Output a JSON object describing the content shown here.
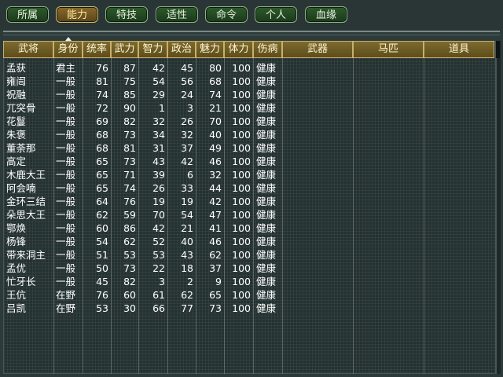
{
  "tabs": [
    {
      "label": "所属"
    },
    {
      "label": "能力"
    },
    {
      "label": "特技"
    },
    {
      "label": "适性"
    },
    {
      "label": "命令"
    },
    {
      "label": "个人"
    },
    {
      "label": "血缘"
    }
  ],
  "active_tab": "能力",
  "columns": [
    "武将",
    "身份",
    "统率",
    "武力",
    "智力",
    "政治",
    "魅力",
    "体力",
    "伤病",
    "武器",
    "马匹",
    "道具"
  ],
  "rows": [
    [
      "孟获",
      "君主",
      "76",
      "87",
      "42",
      "45",
      "80",
      "100",
      "健康"
    ],
    [
      "雍闿",
      "一般",
      "81",
      "75",
      "54",
      "56",
      "68",
      "100",
      "健康"
    ],
    [
      "祝融",
      "一般",
      "74",
      "85",
      "29",
      "24",
      "74",
      "100",
      "健康"
    ],
    [
      "兀突骨",
      "一般",
      "72",
      "90",
      "1",
      "3",
      "21",
      "100",
      "健康"
    ],
    [
      "花鬘",
      "一般",
      "69",
      "82",
      "32",
      "26",
      "70",
      "100",
      "健康"
    ],
    [
      "朱褒",
      "一般",
      "68",
      "73",
      "34",
      "32",
      "40",
      "100",
      "健康"
    ],
    [
      "董荼那",
      "一般",
      "68",
      "81",
      "31",
      "37",
      "49",
      "100",
      "健康"
    ],
    [
      "高定",
      "一般",
      "65",
      "73",
      "43",
      "42",
      "46",
      "100",
      "健康"
    ],
    [
      "木鹿大王",
      "一般",
      "65",
      "71",
      "39",
      "6",
      "32",
      "100",
      "健康"
    ],
    [
      "阿会喃",
      "一般",
      "65",
      "74",
      "26",
      "33",
      "44",
      "100",
      "健康"
    ],
    [
      "金环三结",
      "一般",
      "64",
      "76",
      "19",
      "19",
      "42",
      "100",
      "健康"
    ],
    [
      "朵思大王",
      "一般",
      "62",
      "59",
      "70",
      "54",
      "47",
      "100",
      "健康"
    ],
    [
      "鄂焕",
      "一般",
      "60",
      "86",
      "42",
      "21",
      "41",
      "100",
      "健康"
    ],
    [
      "杨锋",
      "一般",
      "54",
      "62",
      "52",
      "40",
      "46",
      "100",
      "健康"
    ],
    [
      "带来洞主",
      "一般",
      "51",
      "53",
      "53",
      "43",
      "62",
      "100",
      "健康"
    ],
    [
      "孟优",
      "一般",
      "50",
      "73",
      "22",
      "18",
      "37",
      "100",
      "健康"
    ],
    [
      "忙牙长",
      "一般",
      "45",
      "82",
      "3",
      "2",
      "9",
      "100",
      "健康"
    ],
    [
      "王伉",
      "在野",
      "76",
      "60",
      "61",
      "62",
      "65",
      "100",
      "健康"
    ],
    [
      "吕凯",
      "在野",
      "53",
      "30",
      "66",
      "77",
      "73",
      "100",
      "健康"
    ]
  ],
  "colors": {
    "header_bg": "#6e5c24",
    "tab_bg": "#234a23",
    "active_tab_bg": "#7a5c24"
  }
}
